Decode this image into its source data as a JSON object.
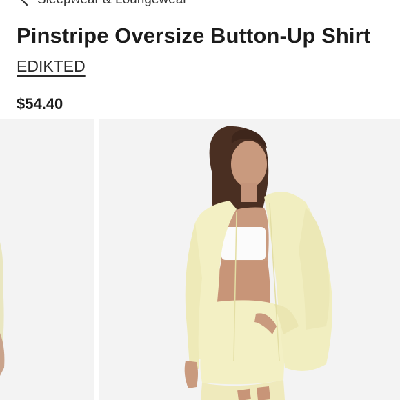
{
  "breadcrumb": {
    "label": "Sleepwear & Loungewear",
    "icon": "chevron-left-icon"
  },
  "product": {
    "title": "Pinstripe Oversize Button-Up Shirt",
    "brand": "EDIKTED",
    "price": "$54.40"
  },
  "colors": {
    "text": "#1b1b1b",
    "image_bg": "#f3f3f3",
    "garment": "#f3f0c4"
  }
}
